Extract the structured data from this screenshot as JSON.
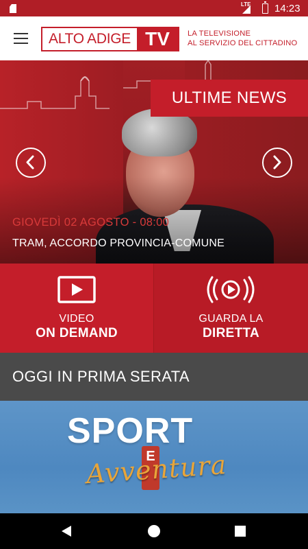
{
  "status_bar": {
    "network": "LTE",
    "time": "14:23"
  },
  "header": {
    "logo_text": "ALTO ADIGE",
    "logo_tv": "TV",
    "tagline_line1": "LA TELEVISIONE",
    "tagline_line2": "AL SERVIZIO DEL CITTADINO"
  },
  "hero": {
    "badge": "ULTIME NEWS",
    "date": "GIOVEDÌ 02 AGOSTO - 08:00",
    "title": "TRAM, ACCORDO PROVINCIA-COMUNE"
  },
  "actions": {
    "vod_line1": "VIDEO",
    "vod_line2": "ON DEMAND",
    "live_line1": "GUARDA LA",
    "live_line2": "DIRETTA"
  },
  "serata": {
    "heading": "OGGI IN PRIMA SERATA"
  },
  "promo": {
    "logo_top": "SPORT",
    "logo_bottom": "Avventura",
    "logo_badge": "E"
  },
  "colors": {
    "brand_red": "#c41e2a",
    "status_bar": "#b01e26",
    "dark_bar": "#4a4a4a",
    "promo_blue": "#5a91c5"
  },
  "icons": [
    "menu-icon",
    "chevron-left-icon",
    "chevron-right-icon",
    "play-screen-icon",
    "live-broadcast-icon",
    "back-icon",
    "home-icon",
    "recent-apps-icon"
  ]
}
